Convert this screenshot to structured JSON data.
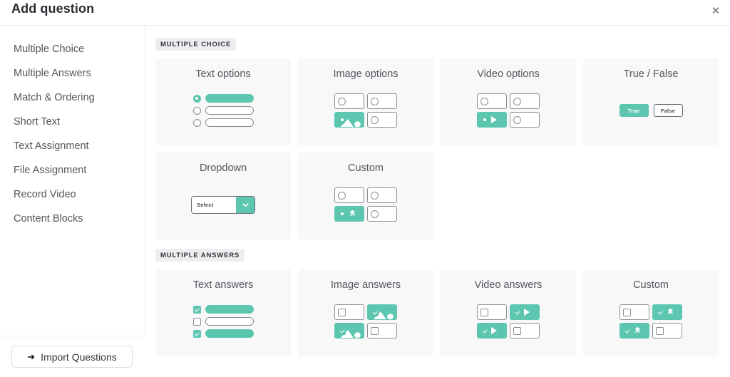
{
  "header": {
    "title": "Add question",
    "close_label": "✕"
  },
  "sidebar": {
    "items": [
      {
        "label": "Multiple Choice"
      },
      {
        "label": "Multiple Answers"
      },
      {
        "label": "Match & Ordering"
      },
      {
        "label": "Short Text"
      },
      {
        "label": "Text Assignment"
      },
      {
        "label": "File Assignment"
      },
      {
        "label": "Record Video"
      },
      {
        "label": "Content Blocks"
      }
    ],
    "import_button": {
      "label": "Import Questions",
      "icon": "arrow-right-icon",
      "arrow": "➜"
    }
  },
  "colors": {
    "accent": "#5CC6B0",
    "card_bg": "#F8F8F9",
    "outline": "#8D8D98",
    "text": "#55555F"
  },
  "main": {
    "sections": [
      {
        "label": "MULTIPLE CHOICE",
        "cards": [
          {
            "title": "Text options",
            "preview": "radio-rows"
          },
          {
            "title": "Image options",
            "preview": "tiles-radio-image"
          },
          {
            "title": "Video options",
            "preview": "tiles-radio-video"
          },
          {
            "title": "True / False",
            "preview": "true-false",
            "true_label": "True",
            "false_label": "False"
          },
          {
            "title": "Dropdown",
            "preview": "dropdown",
            "select_value": "Select"
          },
          {
            "title": "Custom",
            "preview": "tiles-radio-custom"
          }
        ]
      },
      {
        "label": "MULTIPLE ANSWERS",
        "cards": [
          {
            "title": "Text answers",
            "preview": "check-rows"
          },
          {
            "title": "Image answers",
            "preview": "tiles-check-image"
          },
          {
            "title": "Video answers",
            "preview": "tiles-check-video"
          },
          {
            "title": "Custom",
            "preview": "tiles-check-custom"
          }
        ]
      }
    ]
  }
}
